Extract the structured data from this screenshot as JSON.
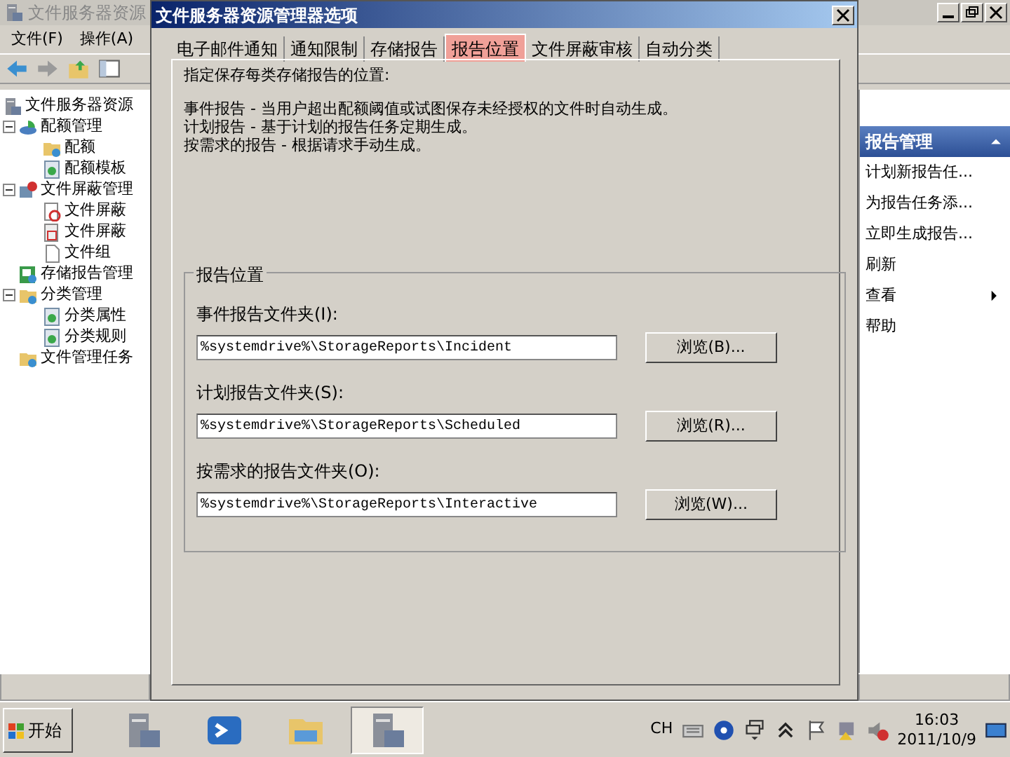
{
  "mmc": {
    "title": "文件服务器资源",
    "menu": [
      "文件(F)",
      "操作(A)"
    ],
    "tree": [
      {
        "label": "文件服务器资源",
        "children": [
          {
            "label": "配额管理",
            "expanded": true,
            "children": [
              {
                "label": "配额"
              },
              {
                "label": "配额模板"
              }
            ]
          },
          {
            "label": "文件屏蔽管理",
            "expanded": true,
            "children": [
              {
                "label": "文件屏蔽"
              },
              {
                "label": "文件屏蔽"
              },
              {
                "label": "文件组"
              }
            ]
          },
          {
            "label": "存储报告管理"
          },
          {
            "label": "分类管理",
            "expanded": true,
            "children": [
              {
                "label": "分类属性"
              },
              {
                "label": "分类规则"
              }
            ]
          },
          {
            "label": "文件管理任务"
          }
        ]
      }
    ],
    "actions": {
      "header": "报告管理",
      "items": [
        {
          "label": "计划新报告任...",
          "kind": "item"
        },
        {
          "label": "为报告任务添...",
          "kind": "item"
        },
        {
          "label": "立即生成报告...",
          "kind": "item"
        },
        {
          "label": "刷新",
          "kind": "item"
        },
        {
          "label": "查看",
          "kind": "submenu"
        },
        {
          "label": "帮助",
          "kind": "item"
        }
      ]
    }
  },
  "dialog": {
    "title": "文件服务器资源管理器选项",
    "tabs": [
      {
        "label": "电子邮件通知",
        "selected": false
      },
      {
        "label": "通知限制",
        "selected": false
      },
      {
        "label": "存储报告",
        "selected": false
      },
      {
        "label": "报告位置",
        "selected": true
      },
      {
        "label": "文件屏蔽审核",
        "selected": false
      },
      {
        "label": "自动分类",
        "selected": false
      }
    ],
    "intro": "指定保存每类存储报告的位置:",
    "descriptions": [
      "事件报告 - 当用户超出配额阈值或试图保存未经授权的文件时自动生成。",
      "计划报告 - 基于计划的报告任务定期生成。",
      "按需求的报告 - 根据请求手动生成。"
    ],
    "group": {
      "legend": "报告位置",
      "rows": [
        {
          "label": "事件报告文件夹(I):",
          "value": "%systemdrive%\\StorageReports\\Incident",
          "button": "浏览(B)..."
        },
        {
          "label": "计划报告文件夹(S):",
          "value": "%systemdrive%\\StorageReports\\Scheduled",
          "button": "浏览(R)..."
        },
        {
          "label": "按需求的报告文件夹(O):",
          "value": "%systemdrive%\\StorageReports\\Interactive",
          "button": "浏览(W)..."
        }
      ]
    }
  },
  "taskbar": {
    "start": "开始",
    "apps": [
      {
        "selected": false
      },
      {
        "selected": false
      },
      {
        "selected": false
      },
      {
        "selected": true
      }
    ],
    "language": "CH",
    "clock": {
      "time": "16:03",
      "date": "2011/10/9"
    }
  }
}
